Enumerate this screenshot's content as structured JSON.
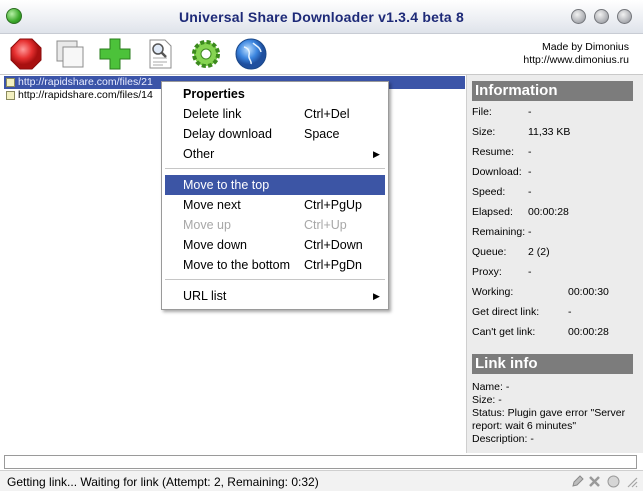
{
  "window": {
    "title": "Universal Share Downloader v1.3.4 beta 8"
  },
  "toolbar": {
    "buttons": [
      {
        "name": "stop",
        "icon": "stop-icon"
      },
      {
        "name": "copy",
        "icon": "copy-icon"
      },
      {
        "name": "add",
        "icon": "add-icon"
      },
      {
        "name": "search",
        "icon": "search-document-icon"
      },
      {
        "name": "settings",
        "icon": "gear-icon"
      },
      {
        "name": "web",
        "icon": "globe-icon"
      }
    ],
    "made_by_line1": "Made by Dimonius",
    "made_by_line2": "http://www.dimonius.ru"
  },
  "downloads": [
    {
      "url": "http://rapidshare.com/files/21"
    },
    {
      "url": "http://rapidshare.com/files/14"
    }
  ],
  "info": {
    "heading": "Information",
    "rows": [
      {
        "label": "File:",
        "value": "-"
      },
      {
        "label": "Size:",
        "value": "11,33 KB"
      },
      {
        "label": "Resume:",
        "value": "-"
      },
      {
        "label": "Download:",
        "value": "-"
      },
      {
        "label": "Speed:",
        "value": "-"
      },
      {
        "label": "Elapsed:",
        "value": "00:00:28"
      },
      {
        "label": "Remaining:",
        "value": "-"
      },
      {
        "label": "Queue:",
        "value": "2 (2)"
      },
      {
        "label": "Proxy:",
        "value": "-"
      },
      {
        "label": "Working:",
        "value": "00:00:30"
      },
      {
        "label": "Get direct link:",
        "value": "-"
      },
      {
        "label": "Can't get link:",
        "value": "00:00:28"
      }
    ]
  },
  "link_info": {
    "heading": "Link info",
    "name": "Name: -",
    "size": "Size: -",
    "status": "Status: Plugin gave error \"Server report: wait 6 minutes\"",
    "description": "Description: -"
  },
  "context_menu": {
    "items": [
      {
        "label": "Properties",
        "shortcut": "",
        "submenu": false
      },
      {
        "label": "Delete link",
        "shortcut": "Ctrl+Del",
        "submenu": false
      },
      {
        "label": "Delay download",
        "shortcut": "Space",
        "submenu": false
      },
      {
        "label": "Other",
        "shortcut": "",
        "submenu": true
      },
      {
        "label": "Move to the top",
        "shortcut": "",
        "submenu": false
      },
      {
        "label": "Move next",
        "shortcut": "Ctrl+PgUp",
        "submenu": false
      },
      {
        "label": "Move up",
        "shortcut": "Ctrl+Up",
        "submenu": false
      },
      {
        "label": "Move down",
        "shortcut": "Ctrl+Down",
        "submenu": false
      },
      {
        "label": "Move to the bottom",
        "shortcut": "Ctrl+PgDn",
        "submenu": false
      },
      {
        "label": "URL list",
        "shortcut": "",
        "submenu": true
      }
    ],
    "submenu_arrow": "▶"
  },
  "status_bar": {
    "text": "Getting link... Waiting for link (Attempt: 2, Remaining: 0:32)"
  },
  "colors": {
    "title_text": "#1e2a78",
    "selection": "#3b54a8",
    "menu_highlight": "#3c55a5",
    "panel_heading": "#7c7c7c"
  }
}
